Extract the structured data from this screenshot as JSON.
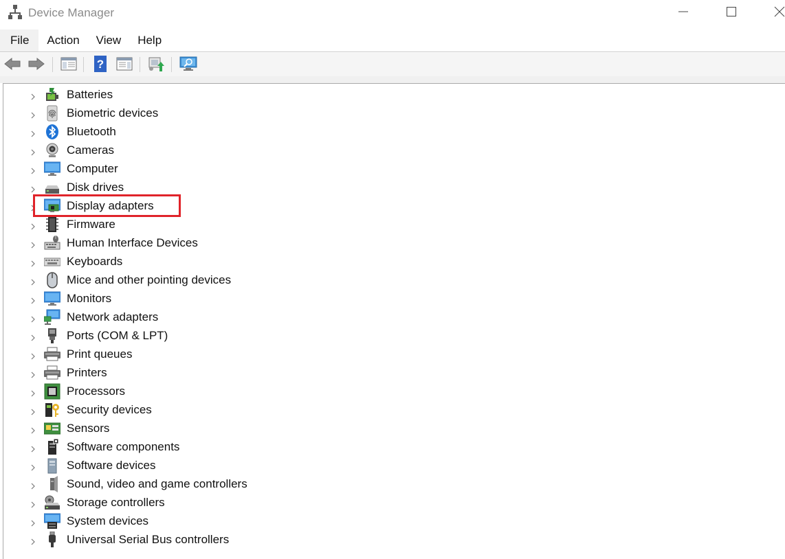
{
  "window": {
    "title": "Device Manager",
    "controls": [
      "minimize-icon",
      "maximize-icon",
      "close-icon"
    ]
  },
  "menu": {
    "file": "File",
    "action": "Action",
    "view": "View",
    "help": "Help"
  },
  "toolbar": {
    "buttons": [
      "back-arrow-icon",
      "forward-arrow-icon",
      "show-hide-console-tree-icon",
      "help-icon",
      "properties-icon",
      "update-driver-icon",
      "scan-hardware-changes-icon"
    ]
  },
  "tree": {
    "selected_highlight_color": "#e0232a",
    "items": [
      {
        "label": "Batteries",
        "icon": "battery-icon"
      },
      {
        "label": "Biometric devices",
        "icon": "fingerprint-icon"
      },
      {
        "label": "Bluetooth",
        "icon": "bluetooth-icon"
      },
      {
        "label": "Cameras",
        "icon": "camera-icon"
      },
      {
        "label": "Computer",
        "icon": "computer-icon"
      },
      {
        "label": "Disk drives",
        "icon": "disk-drive-icon"
      },
      {
        "label": "Display adapters",
        "icon": "display-adapter-icon",
        "highlighted": true
      },
      {
        "label": "Firmware",
        "icon": "firmware-icon"
      },
      {
        "label": "Human Interface Devices",
        "icon": "hid-icon"
      },
      {
        "label": "Keyboards",
        "icon": "keyboard-icon"
      },
      {
        "label": "Mice and other pointing devices",
        "icon": "mouse-icon"
      },
      {
        "label": "Monitors",
        "icon": "monitor-icon"
      },
      {
        "label": "Network adapters",
        "icon": "network-adapter-icon"
      },
      {
        "label": "Ports (COM & LPT)",
        "icon": "port-icon"
      },
      {
        "label": "Print queues",
        "icon": "print-queue-icon"
      },
      {
        "label": "Printers",
        "icon": "printer-icon"
      },
      {
        "label": "Processors",
        "icon": "processor-icon"
      },
      {
        "label": "Security devices",
        "icon": "security-device-icon"
      },
      {
        "label": "Sensors",
        "icon": "sensor-icon"
      },
      {
        "label": "Software components",
        "icon": "software-component-icon"
      },
      {
        "label": "Software devices",
        "icon": "software-device-icon"
      },
      {
        "label": "Sound, video and game controllers",
        "icon": "speaker-icon"
      },
      {
        "label": "Storage controllers",
        "icon": "storage-controller-icon"
      },
      {
        "label": "System devices",
        "icon": "system-device-icon"
      },
      {
        "label": "Universal Serial Bus controllers",
        "icon": "usb-icon"
      }
    ]
  }
}
